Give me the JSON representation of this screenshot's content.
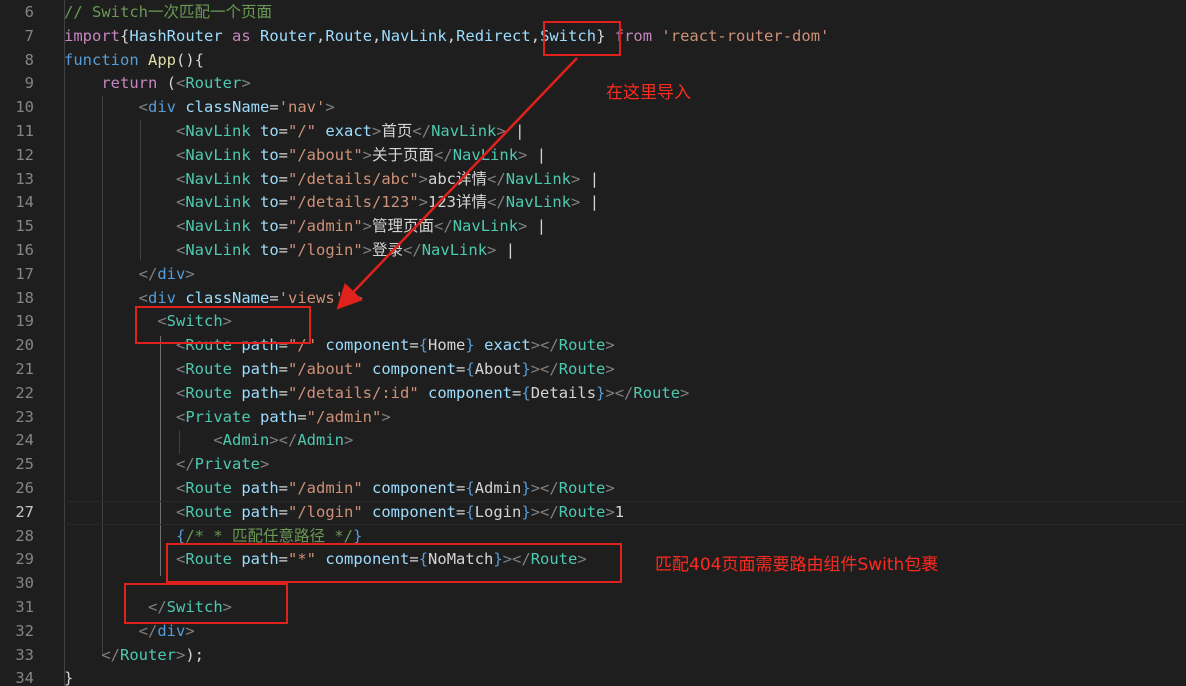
{
  "colors": {
    "background": "#1e1e1e",
    "annotation_red": "#e0221c"
  },
  "lines": [
    {
      "num": "6",
      "tokens": [
        {
          "c": "cm",
          "t": "// Switch一次匹配一个页面"
        }
      ]
    },
    {
      "num": "7",
      "tokens": [
        {
          "c": "kw2",
          "t": "import"
        },
        {
          "c": "txt",
          "t": "{"
        },
        {
          "c": "attr",
          "t": "HashRouter"
        },
        {
          "c": "txt",
          "t": " "
        },
        {
          "c": "kw2",
          "t": "as"
        },
        {
          "c": "txt",
          "t": " "
        },
        {
          "c": "attr",
          "t": "Router"
        },
        {
          "c": "txt",
          "t": ","
        },
        {
          "c": "attr",
          "t": "Route"
        },
        {
          "c": "txt",
          "t": ","
        },
        {
          "c": "attr",
          "t": "NavLink"
        },
        {
          "c": "txt",
          "t": ","
        },
        {
          "c": "attr",
          "t": "Redirect"
        },
        {
          "c": "txt",
          "t": ","
        },
        {
          "c": "attr",
          "t": "Switch"
        },
        {
          "c": "txt",
          "t": "} "
        },
        {
          "c": "kw2",
          "t": "from"
        },
        {
          "c": "txt",
          "t": " "
        },
        {
          "c": "str",
          "t": "'react-router-dom'"
        }
      ]
    },
    {
      "num": "8",
      "tokens": [
        {
          "c": "kw",
          "t": "function"
        },
        {
          "c": "txt",
          "t": " "
        },
        {
          "c": "fn",
          "t": "App"
        },
        {
          "c": "txt",
          "t": "(){"
        }
      ]
    },
    {
      "num": "9",
      "tokens": [
        {
          "c": "txt",
          "t": "    "
        },
        {
          "c": "kw2",
          "t": "return"
        },
        {
          "c": "txt",
          "t": " ("
        },
        {
          "c": "brk",
          "t": "<"
        },
        {
          "c": "comp",
          "t": "Router"
        },
        {
          "c": "brk",
          "t": ">"
        }
      ]
    },
    {
      "num": "10",
      "tokens": [
        {
          "c": "txt",
          "t": "        "
        },
        {
          "c": "brk",
          "t": "<"
        },
        {
          "c": "tag",
          "t": "div"
        },
        {
          "c": "txt",
          "t": " "
        },
        {
          "c": "attr",
          "t": "className"
        },
        {
          "c": "txt",
          "t": "="
        },
        {
          "c": "str",
          "t": "'nav'"
        },
        {
          "c": "brk",
          "t": ">"
        }
      ]
    },
    {
      "num": "11",
      "tokens": [
        {
          "c": "txt",
          "t": "            "
        },
        {
          "c": "brk",
          "t": "<"
        },
        {
          "c": "comp",
          "t": "NavLink"
        },
        {
          "c": "txt",
          "t": " "
        },
        {
          "c": "attr",
          "t": "to"
        },
        {
          "c": "txt",
          "t": "="
        },
        {
          "c": "str",
          "t": "\"/\""
        },
        {
          "c": "txt",
          "t": " "
        },
        {
          "c": "attr",
          "t": "exact"
        },
        {
          "c": "brk",
          "t": ">"
        },
        {
          "c": "txt",
          "t": "首页"
        },
        {
          "c": "brk",
          "t": "</"
        },
        {
          "c": "comp",
          "t": "NavLink"
        },
        {
          "c": "brk",
          "t": ">"
        },
        {
          "c": "txt",
          "t": " |"
        }
      ]
    },
    {
      "num": "12",
      "tokens": [
        {
          "c": "txt",
          "t": "            "
        },
        {
          "c": "brk",
          "t": "<"
        },
        {
          "c": "comp",
          "t": "NavLink"
        },
        {
          "c": "txt",
          "t": " "
        },
        {
          "c": "attr",
          "t": "to"
        },
        {
          "c": "txt",
          "t": "="
        },
        {
          "c": "str",
          "t": "\"/about\""
        },
        {
          "c": "brk",
          "t": ">"
        },
        {
          "c": "txt",
          "t": "关于页面"
        },
        {
          "c": "brk",
          "t": "</"
        },
        {
          "c": "comp",
          "t": "NavLink"
        },
        {
          "c": "brk",
          "t": ">"
        },
        {
          "c": "txt",
          "t": " |"
        }
      ]
    },
    {
      "num": "13",
      "tokens": [
        {
          "c": "txt",
          "t": "            "
        },
        {
          "c": "brk",
          "t": "<"
        },
        {
          "c": "comp",
          "t": "NavLink"
        },
        {
          "c": "txt",
          "t": " "
        },
        {
          "c": "attr",
          "t": "to"
        },
        {
          "c": "txt",
          "t": "="
        },
        {
          "c": "str",
          "t": "\"/details/abc\""
        },
        {
          "c": "brk",
          "t": ">"
        },
        {
          "c": "txt",
          "t": "abc详情"
        },
        {
          "c": "brk",
          "t": "</"
        },
        {
          "c": "comp",
          "t": "NavLink"
        },
        {
          "c": "brk",
          "t": ">"
        },
        {
          "c": "txt",
          "t": " |"
        }
      ]
    },
    {
      "num": "14",
      "tokens": [
        {
          "c": "txt",
          "t": "            "
        },
        {
          "c": "brk",
          "t": "<"
        },
        {
          "c": "comp",
          "t": "NavLink"
        },
        {
          "c": "txt",
          "t": " "
        },
        {
          "c": "attr",
          "t": "to"
        },
        {
          "c": "txt",
          "t": "="
        },
        {
          "c": "str",
          "t": "\"/details/123\""
        },
        {
          "c": "brk",
          "t": ">"
        },
        {
          "c": "txt",
          "t": "123详情"
        },
        {
          "c": "brk",
          "t": "</"
        },
        {
          "c": "comp",
          "t": "NavLink"
        },
        {
          "c": "brk",
          "t": ">"
        },
        {
          "c": "txt",
          "t": " |"
        }
      ]
    },
    {
      "num": "15",
      "tokens": [
        {
          "c": "txt",
          "t": "            "
        },
        {
          "c": "brk",
          "t": "<"
        },
        {
          "c": "comp",
          "t": "NavLink"
        },
        {
          "c": "txt",
          "t": " "
        },
        {
          "c": "attr",
          "t": "to"
        },
        {
          "c": "txt",
          "t": "="
        },
        {
          "c": "str",
          "t": "\"/admin\""
        },
        {
          "c": "brk",
          "t": ">"
        },
        {
          "c": "txt",
          "t": "管理页面"
        },
        {
          "c": "brk",
          "t": "</"
        },
        {
          "c": "comp",
          "t": "NavLink"
        },
        {
          "c": "brk",
          "t": ">"
        },
        {
          "c": "txt",
          "t": " |"
        }
      ]
    },
    {
      "num": "16",
      "tokens": [
        {
          "c": "txt",
          "t": "            "
        },
        {
          "c": "brk",
          "t": "<"
        },
        {
          "c": "comp",
          "t": "NavLink"
        },
        {
          "c": "txt",
          "t": " "
        },
        {
          "c": "attr",
          "t": "to"
        },
        {
          "c": "txt",
          "t": "="
        },
        {
          "c": "str",
          "t": "\"/login\""
        },
        {
          "c": "brk",
          "t": ">"
        },
        {
          "c": "txt",
          "t": "登录"
        },
        {
          "c": "brk",
          "t": "</"
        },
        {
          "c": "comp",
          "t": "NavLink"
        },
        {
          "c": "brk",
          "t": ">"
        },
        {
          "c": "txt",
          "t": " |"
        }
      ]
    },
    {
      "num": "17",
      "tokens": [
        {
          "c": "txt",
          "t": "        "
        },
        {
          "c": "brk",
          "t": "</"
        },
        {
          "c": "tag",
          "t": "div"
        },
        {
          "c": "brk",
          "t": ">"
        }
      ]
    },
    {
      "num": "18",
      "tokens": [
        {
          "c": "txt",
          "t": "        "
        },
        {
          "c": "brk",
          "t": "<"
        },
        {
          "c": "tag",
          "t": "div"
        },
        {
          "c": "txt",
          "t": " "
        },
        {
          "c": "attr",
          "t": "className"
        },
        {
          "c": "txt",
          "t": "="
        },
        {
          "c": "str",
          "t": "'views'"
        },
        {
          "c": "txt",
          "t": " "
        },
        {
          "c": "brk",
          "t": ">"
        }
      ]
    },
    {
      "num": "19",
      "tokens": [
        {
          "c": "txt",
          "t": "          "
        },
        {
          "c": "brk",
          "t": "<"
        },
        {
          "c": "comp",
          "t": "Switch"
        },
        {
          "c": "brk",
          "t": ">"
        }
      ]
    },
    {
      "num": "20",
      "tokens": [
        {
          "c": "txt",
          "t": "            "
        },
        {
          "c": "brk",
          "t": "<"
        },
        {
          "c": "comp",
          "t": "Route"
        },
        {
          "c": "txt",
          "t": " "
        },
        {
          "c": "attr",
          "t": "path"
        },
        {
          "c": "txt",
          "t": "="
        },
        {
          "c": "str",
          "t": "\"/\""
        },
        {
          "c": "txt",
          "t": " "
        },
        {
          "c": "attr",
          "t": "component"
        },
        {
          "c": "txt",
          "t": "="
        },
        {
          "c": "kw",
          "t": "{"
        },
        {
          "c": "txt",
          "t": "Home"
        },
        {
          "c": "kw",
          "t": "}"
        },
        {
          "c": "txt",
          "t": " "
        },
        {
          "c": "attr",
          "t": "exact"
        },
        {
          "c": "brk",
          "t": "></"
        },
        {
          "c": "comp",
          "t": "Route"
        },
        {
          "c": "brk",
          "t": ">"
        }
      ]
    },
    {
      "num": "21",
      "tokens": [
        {
          "c": "txt",
          "t": "            "
        },
        {
          "c": "brk",
          "t": "<"
        },
        {
          "c": "comp",
          "t": "Route"
        },
        {
          "c": "txt",
          "t": " "
        },
        {
          "c": "attr",
          "t": "path"
        },
        {
          "c": "txt",
          "t": "="
        },
        {
          "c": "str",
          "t": "\"/about\""
        },
        {
          "c": "txt",
          "t": " "
        },
        {
          "c": "attr",
          "t": "component"
        },
        {
          "c": "txt",
          "t": "="
        },
        {
          "c": "kw",
          "t": "{"
        },
        {
          "c": "txt",
          "t": "About"
        },
        {
          "c": "kw",
          "t": "}"
        },
        {
          "c": "brk",
          "t": "></"
        },
        {
          "c": "comp",
          "t": "Route"
        },
        {
          "c": "brk",
          "t": ">"
        }
      ]
    },
    {
      "num": "22",
      "tokens": [
        {
          "c": "txt",
          "t": "            "
        },
        {
          "c": "brk",
          "t": "<"
        },
        {
          "c": "comp",
          "t": "Route"
        },
        {
          "c": "txt",
          "t": " "
        },
        {
          "c": "attr",
          "t": "path"
        },
        {
          "c": "txt",
          "t": "="
        },
        {
          "c": "str",
          "t": "\"/details/:id\""
        },
        {
          "c": "txt",
          "t": " "
        },
        {
          "c": "attr",
          "t": "component"
        },
        {
          "c": "txt",
          "t": "="
        },
        {
          "c": "kw",
          "t": "{"
        },
        {
          "c": "txt",
          "t": "Details"
        },
        {
          "c": "kw",
          "t": "}"
        },
        {
          "c": "brk",
          "t": "></"
        },
        {
          "c": "comp",
          "t": "Route"
        },
        {
          "c": "brk",
          "t": ">"
        }
      ]
    },
    {
      "num": "23",
      "tokens": [
        {
          "c": "txt",
          "t": "            "
        },
        {
          "c": "brk",
          "t": "<"
        },
        {
          "c": "comp",
          "t": "Private"
        },
        {
          "c": "txt",
          "t": " "
        },
        {
          "c": "attr",
          "t": "path"
        },
        {
          "c": "txt",
          "t": "="
        },
        {
          "c": "str",
          "t": "\"/admin\""
        },
        {
          "c": "brk",
          "t": ">"
        }
      ]
    },
    {
      "num": "24",
      "tokens": [
        {
          "c": "txt",
          "t": "                "
        },
        {
          "c": "brk",
          "t": "<"
        },
        {
          "c": "comp",
          "t": "Admin"
        },
        {
          "c": "brk",
          "t": "></"
        },
        {
          "c": "comp",
          "t": "Admin"
        },
        {
          "c": "brk",
          "t": ">"
        }
      ]
    },
    {
      "num": "25",
      "tokens": [
        {
          "c": "txt",
          "t": "            "
        },
        {
          "c": "brk",
          "t": "</"
        },
        {
          "c": "comp",
          "t": "Private"
        },
        {
          "c": "brk",
          "t": ">"
        }
      ]
    },
    {
      "num": "26",
      "tokens": [
        {
          "c": "txt",
          "t": "            "
        },
        {
          "c": "brk",
          "t": "<"
        },
        {
          "c": "comp",
          "t": "Route"
        },
        {
          "c": "txt",
          "t": " "
        },
        {
          "c": "attr",
          "t": "path"
        },
        {
          "c": "txt",
          "t": "="
        },
        {
          "c": "str",
          "t": "\"/admin\""
        },
        {
          "c": "txt",
          "t": " "
        },
        {
          "c": "attr",
          "t": "component"
        },
        {
          "c": "txt",
          "t": "="
        },
        {
          "c": "kw",
          "t": "{"
        },
        {
          "c": "txt",
          "t": "Admin"
        },
        {
          "c": "kw",
          "t": "}"
        },
        {
          "c": "brk",
          "t": "></"
        },
        {
          "c": "comp",
          "t": "Route"
        },
        {
          "c": "brk",
          "t": ">"
        }
      ]
    },
    {
      "num": "27",
      "current": true,
      "tokens": [
        {
          "c": "txt",
          "t": "            "
        },
        {
          "c": "brk",
          "t": "<"
        },
        {
          "c": "comp",
          "t": "Route"
        },
        {
          "c": "txt",
          "t": " "
        },
        {
          "c": "attr",
          "t": "path"
        },
        {
          "c": "txt",
          "t": "="
        },
        {
          "c": "str",
          "t": "\"/login\""
        },
        {
          "c": "txt",
          "t": " "
        },
        {
          "c": "attr",
          "t": "component"
        },
        {
          "c": "txt",
          "t": "="
        },
        {
          "c": "kw",
          "t": "{"
        },
        {
          "c": "txt",
          "t": "Login"
        },
        {
          "c": "kw",
          "t": "}"
        },
        {
          "c": "brk",
          "t": "></"
        },
        {
          "c": "comp",
          "t": "Route"
        },
        {
          "c": "brk",
          "t": ">"
        },
        {
          "c": "txt",
          "t": "1"
        }
      ]
    },
    {
      "num": "28",
      "tokens": [
        {
          "c": "txt",
          "t": "            "
        },
        {
          "c": "kw",
          "t": "{"
        },
        {
          "c": "cm",
          "t": "/* * 匹配任意路径 */"
        },
        {
          "c": "kw",
          "t": "}"
        }
      ]
    },
    {
      "num": "29",
      "tokens": [
        {
          "c": "txt",
          "t": "            "
        },
        {
          "c": "brk",
          "t": "<"
        },
        {
          "c": "comp",
          "t": "Route"
        },
        {
          "c": "txt",
          "t": " "
        },
        {
          "c": "attr",
          "t": "path"
        },
        {
          "c": "txt",
          "t": "="
        },
        {
          "c": "str",
          "t": "\"*\""
        },
        {
          "c": "txt",
          "t": " "
        },
        {
          "c": "attr",
          "t": "component"
        },
        {
          "c": "txt",
          "t": "="
        },
        {
          "c": "kw",
          "t": "{"
        },
        {
          "c": "txt",
          "t": "NoMatch"
        },
        {
          "c": "kw",
          "t": "}"
        },
        {
          "c": "brk",
          "t": "></"
        },
        {
          "c": "comp",
          "t": "Route"
        },
        {
          "c": "brk",
          "t": ">"
        }
      ]
    },
    {
      "num": "30",
      "tokens": []
    },
    {
      "num": "31",
      "tokens": [
        {
          "c": "txt",
          "t": "         "
        },
        {
          "c": "brk",
          "t": "</"
        },
        {
          "c": "comp",
          "t": "Switch"
        },
        {
          "c": "brk",
          "t": ">"
        }
      ]
    },
    {
      "num": "32",
      "tokens": [
        {
          "c": "txt",
          "t": "        "
        },
        {
          "c": "brk",
          "t": "</"
        },
        {
          "c": "tag",
          "t": "div"
        },
        {
          "c": "brk",
          "t": ">"
        }
      ]
    },
    {
      "num": "33",
      "tokens": [
        {
          "c": "txt",
          "t": "    "
        },
        {
          "c": "brk",
          "t": "</"
        },
        {
          "c": "comp",
          "t": "Router"
        },
        {
          "c": "brk",
          "t": ">"
        },
        {
          "c": "txt",
          "t": ");"
        }
      ]
    },
    {
      "num": "34",
      "tokens": [
        {
          "c": "txt",
          "t": "}"
        }
      ]
    }
  ],
  "annotations": {
    "import_note": "在这里导入",
    "switch_note": "匹配404页面需要路由组件Swith包裹"
  }
}
